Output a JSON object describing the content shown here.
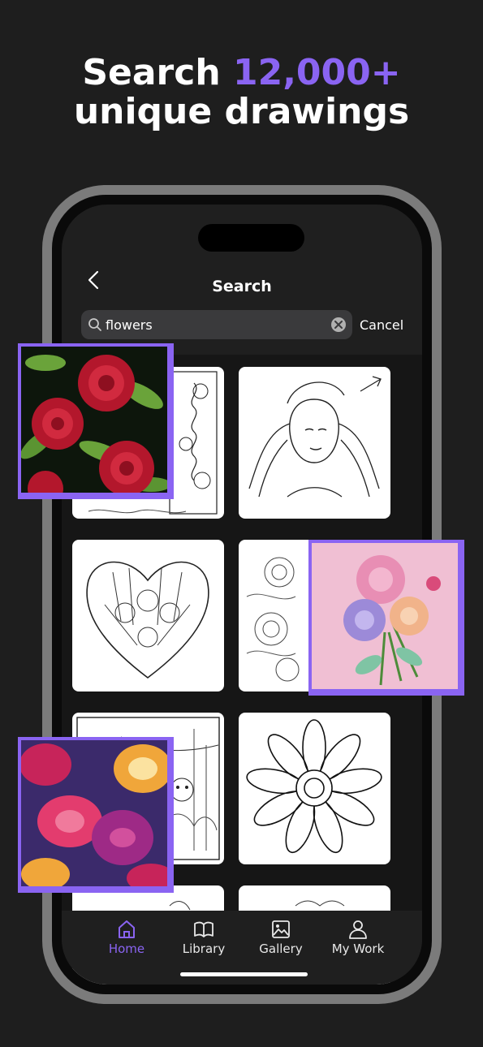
{
  "headline": {
    "line1_prefix": "Search",
    "line1_accent": "12,000+",
    "line2": "unique drawings"
  },
  "screen": {
    "title": "Search"
  },
  "search": {
    "value": "flowers",
    "cancel_label": "Cancel"
  },
  "tabs": [
    {
      "label": "Home",
      "icon": "home-icon",
      "active": true
    },
    {
      "label": "Library",
      "icon": "book-icon",
      "active": false
    },
    {
      "label": "Gallery",
      "icon": "image-icon",
      "active": false
    },
    {
      "label": "My Work",
      "icon": "person-icon",
      "active": false
    }
  ],
  "colors": {
    "accent": "#8a64f2",
    "background": "#1e1e1e",
    "phone_frame": "#7b7b7b"
  }
}
